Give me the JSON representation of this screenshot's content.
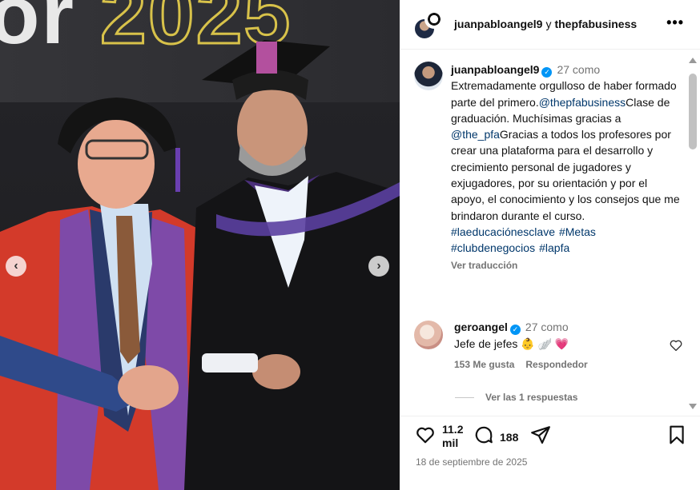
{
  "photo": {
    "banner_prefix": "or",
    "banner_year": "2025",
    "prev_icon": "chevron-left-icon",
    "next_icon": "chevron-right-icon"
  },
  "header": {
    "user1": "juanpabloangel9",
    "joiner": "y",
    "user2": "thepfabusiness",
    "more_icon": "more-horizontal-icon"
  },
  "caption": {
    "username": "juanpabloangel9",
    "time": "27 como",
    "text_1": "Extremadamente orgulloso de haber formado parte del primero.",
    "mention_1": "@thepfabusiness",
    "text_2": "Clase de graduación. Muchísimas gracias a",
    "mention_2": "@the_pfa",
    "text_3": "Gracias a todos los profesores por crear una plataforma para el desarrollo y crecimiento personal de jugadores y exjugadores, por su orientación y por el apoyo, el conocimiento y los consejos que me brindaron durante el curso.",
    "hashtags": [
      "#laeducaciónesclave",
      "#Metas",
      "#clubdenegocios",
      "#lapfa"
    ],
    "see_translation": "Ver traducción"
  },
  "comment": {
    "username": "geroangel",
    "time": "27 como",
    "text": "Jefe de jefes 👶 🪽 💗",
    "likes": "153 Me gusta",
    "reply": "Respondedor",
    "view_replies": "Ver las 1 respuestas"
  },
  "actions": {
    "likes": "11.2",
    "likes_unit": "mil",
    "comments": "188",
    "date": "18 de septiembre de 2025"
  },
  "colors": {
    "link": "#00376b",
    "verified": "#0095f6",
    "muted": "#737373"
  }
}
